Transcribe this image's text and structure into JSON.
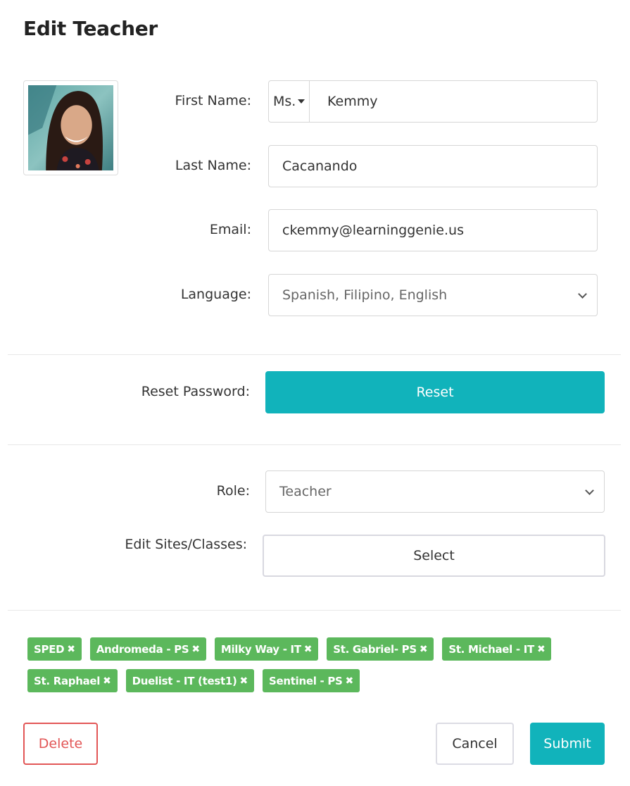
{
  "title": "Edit Teacher",
  "form": {
    "first_name_label": "First Name:",
    "prefix": "Ms.",
    "first_name": "Kemmy",
    "last_name_label": "Last Name:",
    "last_name": "Cacanando",
    "email_label": "Email:",
    "email": "ckemmy@learninggenie.us",
    "language_label": "Language:",
    "language": "Spanish, Filipino, English",
    "reset_label": "Reset Password:",
    "reset_button": "Reset",
    "role_label": "Role:",
    "role": "Teacher",
    "sites_label": "Edit Sites/Classes:",
    "select_button": "Select"
  },
  "tags": [
    {
      "label": "SPED"
    },
    {
      "label": "Andromeda - PS"
    },
    {
      "label": "Milky Way - IT"
    },
    {
      "label": "St. Gabriel- PS"
    },
    {
      "label": "St. Michael - IT"
    },
    {
      "label": "St. Raphael"
    },
    {
      "label": "Duelist - IT (test1)"
    },
    {
      "label": "Sentinel - PS"
    }
  ],
  "tag_remove_glyph": "✖",
  "actions": {
    "delete": "Delete",
    "cancel": "Cancel",
    "submit": "Submit"
  },
  "colors": {
    "accent": "#11b3bb",
    "tag": "#5cb85c",
    "danger": "#e25656"
  }
}
